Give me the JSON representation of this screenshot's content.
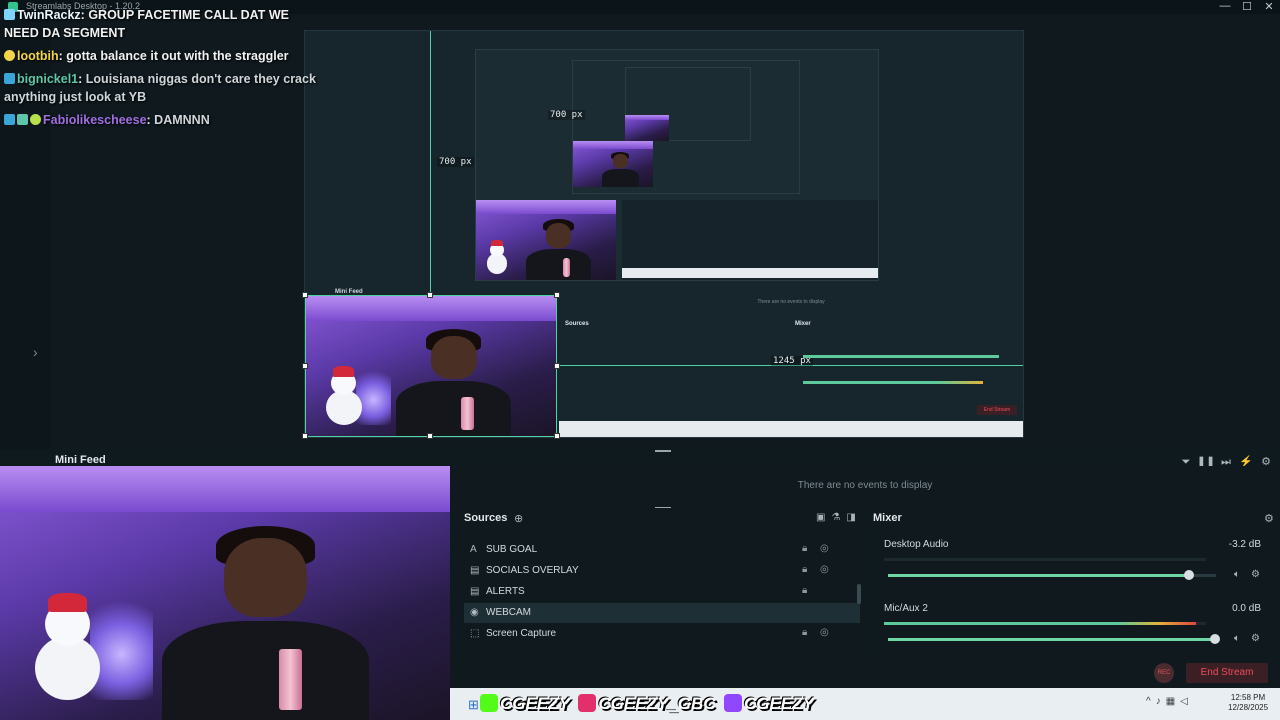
{
  "window": {
    "title": "Streamlabs Desktop - 1.20.2",
    "minimize": "—",
    "maximize": "☐",
    "close": "✕"
  },
  "chat": [
    {
      "user": "TwinRackz",
      "message": "GROUP FACETIME CALL DAT WE NEED DA SEGMENT",
      "color": "#7fd3ff"
    },
    {
      "user": "lootbih",
      "message": "gotta balance it out with the straggler",
      "color": "#f3d54a"
    },
    {
      "user": "bignickel1",
      "message": "Louisiana niggas don't care they crack anything just look at YB",
      "color": "#5ec5a8"
    },
    {
      "user": "Fabiolikescheese",
      "message": "DAMNNN",
      "color": "#9f6ee0"
    }
  ],
  "preview": {
    "guide_vertical_label": "700 px",
    "guide_horizontal_label": "1245 px",
    "inner_guide_label": "700 px",
    "minifeed_label": "Mini Feed",
    "no_events": "There are no events to display",
    "sources_label": "Sources",
    "mixer_label": "Mixer",
    "end_stream": "End Stream"
  },
  "minifeed": {
    "label": "Mini Feed",
    "no_events": "There are no events to display",
    "controls": [
      "filter-icon",
      "pause-icon",
      "skip-icon",
      "mute-icon",
      "gear-icon"
    ]
  },
  "sources": {
    "label": "Sources",
    "items": [
      {
        "name": "SUB GOAL",
        "icon": "text-icon",
        "locked": true,
        "visible": true
      },
      {
        "name": "SOCIALS OVERLAY",
        "icon": "image-icon",
        "locked": true,
        "visible": true
      },
      {
        "name": "ALERTS",
        "icon": "alert-icon",
        "locked": true,
        "visible": false
      },
      {
        "name": "WEBCAM",
        "icon": "webcam-icon",
        "locked": false,
        "visible": false,
        "selected": true
      },
      {
        "name": "Screen Capture",
        "icon": "screen-icon",
        "locked": true,
        "visible": true
      }
    ]
  },
  "mixer": {
    "label": "Mixer",
    "channels": [
      {
        "name": "Desktop Audio",
        "db": "-3.2 dB",
        "meter": 0.0,
        "volume": 0.92
      },
      {
        "name": "Mic/Aux 2",
        "db": "0.0 dB",
        "meter": 0.97,
        "volume": 1.0
      }
    ]
  },
  "stream": {
    "rec": "REC",
    "end_stream": "End Stream"
  },
  "overlay_socials": [
    {
      "handle": "CGEEZY",
      "icon": "kick-icon",
      "color": "#53fc18"
    },
    {
      "handle": "CGEEZY_GBC",
      "icon": "instagram-icon",
      "color": "#e1306c"
    },
    {
      "handle": "CGEEZY",
      "icon": "twitch-icon",
      "color": "#9146ff"
    }
  ],
  "taskbar": {
    "time": "12:58 PM",
    "date": "12/28/2025"
  }
}
